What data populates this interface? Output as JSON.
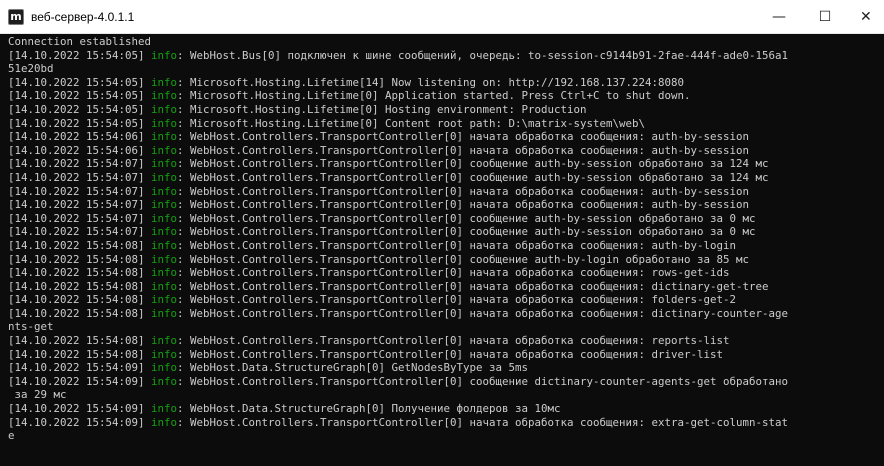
{
  "window": {
    "icon_letter": "m",
    "title": "веб-сервер-4.0.1.1",
    "controls": {
      "minimize": "—",
      "maximize": "☐",
      "close": "✕"
    }
  },
  "console": {
    "lines": [
      {
        "text": "Connection established"
      },
      {
        "prefix": "[14.10.2022 15:54:05] ",
        "level": "info",
        "text": ": WebHost.Bus[0] подключен к шине сообщений, очередь: to-session-c9144b91-2fae-444f-ade0-156a1"
      },
      {
        "text": "51e20bd"
      },
      {
        "prefix": "[14.10.2022 15:54:05] ",
        "level": "info",
        "text": ": Microsoft.Hosting.Lifetime[14] Now listening on: http://192.168.137.224:8080"
      },
      {
        "prefix": "[14.10.2022 15:54:05] ",
        "level": "info",
        "text": ": Microsoft.Hosting.Lifetime[0] Application started. Press Ctrl+C to shut down."
      },
      {
        "prefix": "[14.10.2022 15:54:05] ",
        "level": "info",
        "text": ": Microsoft.Hosting.Lifetime[0] Hosting environment: Production"
      },
      {
        "prefix": "[14.10.2022 15:54:05] ",
        "level": "info",
        "text": ": Microsoft.Hosting.Lifetime[0] Content root path: D:\\matrix-system\\web\\"
      },
      {
        "prefix": "[14.10.2022 15:54:06] ",
        "level": "info",
        "text": ": WebHost.Controllers.TransportController[0] начата обработка сообщения: auth-by-session"
      },
      {
        "prefix": "[14.10.2022 15:54:06] ",
        "level": "info",
        "text": ": WebHost.Controllers.TransportController[0] начата обработка сообщения: auth-by-session"
      },
      {
        "prefix": "[14.10.2022 15:54:07] ",
        "level": "info",
        "text": ": WebHost.Controllers.TransportController[0] сообщение auth-by-session обработано за 124 мс"
      },
      {
        "prefix": "[14.10.2022 15:54:07] ",
        "level": "info",
        "text": ": WebHost.Controllers.TransportController[0] сообщение auth-by-session обработано за 124 мс"
      },
      {
        "prefix": "[14.10.2022 15:54:07] ",
        "level": "info",
        "text": ": WebHost.Controllers.TransportController[0] начата обработка сообщения: auth-by-session"
      },
      {
        "prefix": "[14.10.2022 15:54:07] ",
        "level": "info",
        "text": ": WebHost.Controllers.TransportController[0] начата обработка сообщения: auth-by-session"
      },
      {
        "prefix": "[14.10.2022 15:54:07] ",
        "level": "info",
        "text": ": WebHost.Controllers.TransportController[0] сообщение auth-by-session обработано за 0 мс"
      },
      {
        "prefix": "[14.10.2022 15:54:07] ",
        "level": "info",
        "text": ": WebHost.Controllers.TransportController[0] сообщение auth-by-session обработано за 0 мс"
      },
      {
        "prefix": "[14.10.2022 15:54:08] ",
        "level": "info",
        "text": ": WebHost.Controllers.TransportController[0] начата обработка сообщения: auth-by-login"
      },
      {
        "prefix": "[14.10.2022 15:54:08] ",
        "level": "info",
        "text": ": WebHost.Controllers.TransportController[0] сообщение auth-by-login обработано за 85 мс"
      },
      {
        "prefix": "[14.10.2022 15:54:08] ",
        "level": "info",
        "text": ": WebHost.Controllers.TransportController[0] начата обработка сообщения: rows-get-ids"
      },
      {
        "prefix": "[14.10.2022 15:54:08] ",
        "level": "info",
        "text": ": WebHost.Controllers.TransportController[0] начата обработка сообщения: dictinary-get-tree"
      },
      {
        "prefix": "[14.10.2022 15:54:08] ",
        "level": "info",
        "text": ": WebHost.Controllers.TransportController[0] начата обработка сообщения: folders-get-2"
      },
      {
        "prefix": "[14.10.2022 15:54:08] ",
        "level": "info",
        "text": ": WebHost.Controllers.TransportController[0] начата обработка сообщения: dictinary-counter-age"
      },
      {
        "text": "nts-get"
      },
      {
        "prefix": "[14.10.2022 15:54:08] ",
        "level": "info",
        "text": ": WebHost.Controllers.TransportController[0] начата обработка сообщения: reports-list"
      },
      {
        "prefix": "[14.10.2022 15:54:08] ",
        "level": "info",
        "text": ": WebHost.Controllers.TransportController[0] начата обработка сообщения: driver-list"
      },
      {
        "prefix": "[14.10.2022 15:54:09] ",
        "level": "info",
        "text": ": WebHost.Data.StructureGraph[0] GetNodesByType за 5ms"
      },
      {
        "prefix": "[14.10.2022 15:54:09] ",
        "level": "info",
        "text": ": WebHost.Controllers.TransportController[0] сообщение dictinary-counter-agents-get обработано"
      },
      {
        "text": " за 29 мс"
      },
      {
        "prefix": "[14.10.2022 15:54:09] ",
        "level": "info",
        "text": ": WebHost.Data.StructureGraph[0] Получение фолдеров за 10мс"
      },
      {
        "prefix": "[14.10.2022 15:54:09] ",
        "level": "info",
        "text": ": WebHost.Controllers.TransportController[0] начата обработка сообщения: extra-get-column-stat"
      },
      {
        "text": "e"
      }
    ]
  },
  "colors": {
    "background": "#0c0c0c",
    "text": "#cccccc",
    "info": "#13a10e"
  }
}
